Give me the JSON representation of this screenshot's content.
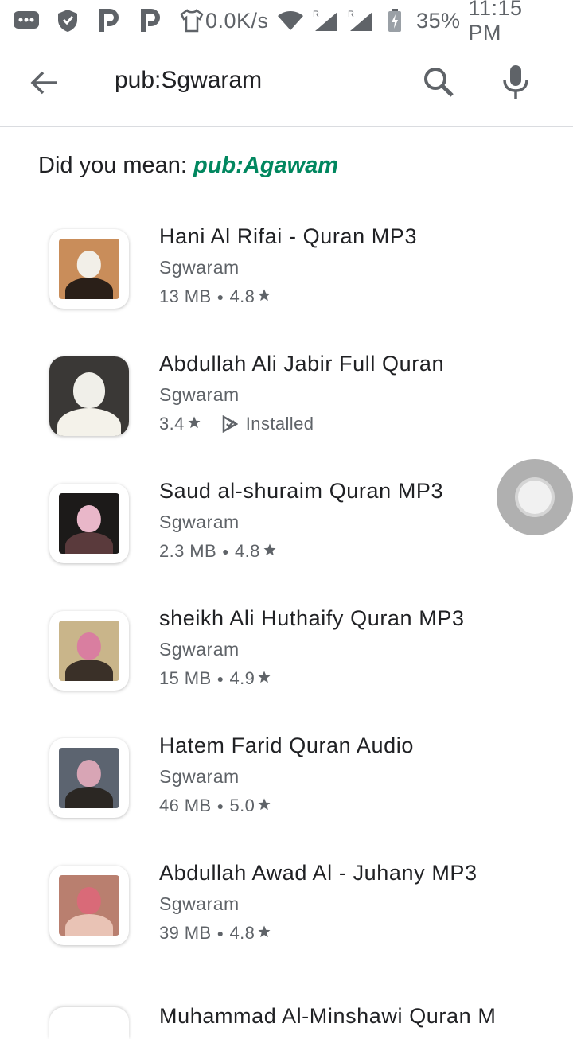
{
  "status_bar": {
    "speed": "0.0K/s",
    "battery": "35%",
    "time": "11:15 PM",
    "icons": [
      "message-icon",
      "shield-icon",
      "parking-icon",
      "parking-icon",
      "shirt-icon",
      "wifi-icon",
      "signal-icon",
      "signal-icon",
      "battery-icon"
    ]
  },
  "search": {
    "query": "pub:Sgwaram"
  },
  "did_you_mean": {
    "label": "Did you mean:",
    "suggestion": "pub:Agawam"
  },
  "apps": [
    {
      "title": "Hani Al Rifai - Quran MP3",
      "developer": "Sgwaram",
      "size": "13 MB",
      "rating": "4.8",
      "installed": false,
      "colors": {
        "bg": "#c98d5a",
        "head": "#f2efe8",
        "body": "#2a1f18"
      }
    },
    {
      "title": "Abdullah Ali Jabir Full Quran",
      "developer": "Sgwaram",
      "rating": "3.4",
      "installed_label": "Installed",
      "installed": true,
      "colors": {
        "bg": "#3a3836",
        "head": "#f0efe9",
        "body": "#f4f2ea"
      }
    },
    {
      "title": "Saud al-shuraim Quran MP3",
      "developer": "Sgwaram",
      "size": "2.3 MB",
      "rating": "4.8",
      "installed": false,
      "colors": {
        "bg": "#1c1a19",
        "head": "#e9b7c9",
        "body": "#5a3a3c"
      }
    },
    {
      "title": "sheikh Ali Huthaify Quran MP3",
      "developer": "Sgwaram",
      "size": "15 MB",
      "rating": "4.9",
      "installed": false,
      "colors": {
        "bg": "#c9b58a",
        "head": "#d97ea0",
        "body": "#3a3028"
      }
    },
    {
      "title": "Hatem Farid Quran Audio",
      "developer": "Sgwaram",
      "size": "46 MB",
      "rating": "5.0",
      "installed": false,
      "colors": {
        "bg": "#5c6470",
        "head": "#d8a5b5",
        "body": "#2b2723"
      }
    },
    {
      "title": "Abdullah Awad Al - Juhany MP3",
      "developer": "Sgwaram",
      "size": "39 MB",
      "rating": "4.8",
      "installed": false,
      "colors": {
        "bg": "#b97f6f",
        "head": "#d96a78",
        "body": "#e9c3b5"
      }
    }
  ],
  "partial_app": {
    "title": "Muhammad Al-Minshawi Quran M"
  },
  "colors": {
    "suggestion": "#01875f",
    "secondary_text": "#5f6368"
  }
}
